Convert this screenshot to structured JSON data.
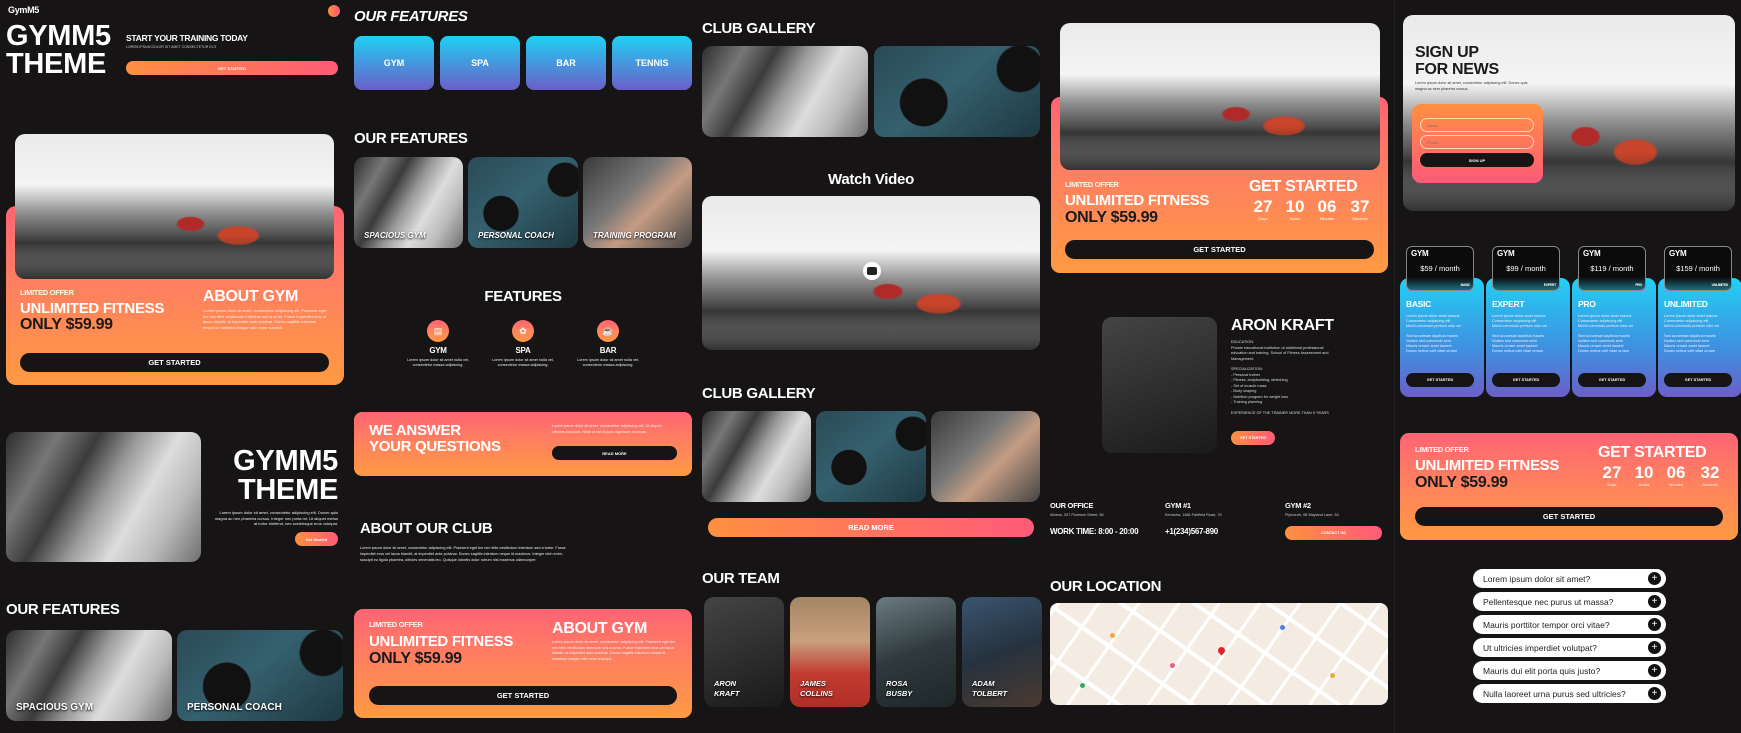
{
  "col1": {
    "brand": "GymM5",
    "hero_title_line1": "GYMM5",
    "hero_title_line2": "THEME",
    "hero_subtitle": "START YOUR TRAINING TODAY",
    "hero_text": "LOREM IPSUM DOLOR SIT AMET CONSECTETUR ELIT",
    "hero_button": "GET STARTED",
    "offer": {
      "kicker": "LIMITED OFFER",
      "title": "UNLIMITED FITNESS",
      "price": "ONLY $59.99",
      "about_title": "ABOUT GYM",
      "about_text": "Lorem ipsum dolor sit amet, consectetur adipiscing elit. Praesent eget leo nec felis vestibulum interdum sed a tortor. Fusce imperdiet eros ut lacus blandit, at imperdiet ante pulvinar. Donec sagittis interdum neque id maximus integer nibh enim suscipit.",
      "button": "GET STARTED"
    },
    "hero2": {
      "title_line1": "GYMM5",
      "title_line2": "THEME",
      "text": "Lorem ipsum dolor sit amet, consectetur adipiscing elit. Donec quis magna ac nen pharetra cursus. Integer nec porta mi. Ut aliquet metus at tortor eleifend, nec scelerisque eros volutpat.",
      "button": "Get Started"
    },
    "features_title": "OUR FEATURES",
    "features": [
      {
        "caption": "SPACIOUS GYM"
      },
      {
        "caption": "PERSONAL COACH"
      }
    ]
  },
  "col2": {
    "tiles_title": "OUR FEATURES",
    "tiles": [
      "GYM",
      "SPA",
      "BAR",
      "TENNIS"
    ],
    "photo_title": "OUR FEATURES",
    "photos": [
      {
        "caption": "SPACIOUS GYM"
      },
      {
        "caption": "PERSONAL COACH"
      },
      {
        "caption": "TRAINING PROGRAM"
      }
    ],
    "features_heading": "FEATURES",
    "features": [
      {
        "icon": "dumbbell-icon",
        "glyph": "▤",
        "title": "GYM",
        "text": "Lorem ipsum dolor sit amet nulla vel, consectetur massa adipiscing."
      },
      {
        "icon": "spa-icon",
        "glyph": "✿",
        "title": "SPA",
        "text": "Lorem ipsum dolor sit amet nulla vel, consectetur massa adipiscing."
      },
      {
        "icon": "cup-icon",
        "glyph": "☕",
        "title": "BAR",
        "text": "Lorem ipsum dolor sit amet nulla vel, consectetur massa adipiscing."
      }
    ],
    "faq_banner": {
      "title_line1": "WE ANSWER",
      "title_line2": "YOUR QUESTIONS",
      "text": "Lorem ipsum dolor sit amet, consectetur adipiscing elit. Ut aliquet ultricies tincidunt. Nulla ut est id justo dignissim rhoncus.",
      "button": "READ MORE"
    },
    "about_club": {
      "title": "ABOUT OUR CLUB",
      "text": "Lorem ipsum dolor sit amet, consectetur adipiscing elit. Praesent eget leo nec felis vestibulum interdum sed a tortor. Fusce imperdiet eros vel lacus blandit, at imperdiet ante pulvinar. Donec sagittis interdum neque id maximus. Integer nibh enim, suscipit eu ligula pharetra, ultrices venenatis leo. Quisque lobortis dolor rutrum nisl maximus ullamcorper."
    },
    "offer": {
      "kicker": "LIMITED OFFER",
      "title": "UNLIMITED FITNESS",
      "price": "ONLY $59.99",
      "about_title": "ABOUT GYM",
      "about_text": "Lorem ipsum dolor sit amet, consectetur adipiscing elit. Praesent eget leo nec felis vestibulum interdum sed a tortor. Fusce imperdiet eros vel lacus blandit, at imperdiet ante pulvinar. Donec sagittis interdum neque id maximus integer nibh enim suscipit.",
      "button": "GET STARTED"
    }
  },
  "col3": {
    "gallery_title": "CLUB GALLERY",
    "video_title": "Watch Video",
    "gallery2_title": "CLUB GALLERY",
    "read_more": "READ MORE",
    "team_title": "OUR TEAM",
    "team": [
      {
        "first": "ARON",
        "last": "KRAFT"
      },
      {
        "first": "JAMES",
        "last": "COLLINS"
      },
      {
        "first": "ROSA",
        "last": "BUSBY"
      },
      {
        "first": "ADAM",
        "last": "TOLBERT"
      }
    ]
  },
  "col4": {
    "offer": {
      "kicker": "LIMITED OFFER",
      "title": "UNLIMITED FITNESS",
      "price": "ONLY $59.99",
      "cta_title": "GET STARTED",
      "countdown": [
        {
          "value": "27",
          "label": "Days"
        },
        {
          "value": "10",
          "label": "Hours"
        },
        {
          "value": "06",
          "label": "Minutes"
        },
        {
          "value": "37",
          "label": "Seconds"
        }
      ],
      "button": "GET STARTED"
    },
    "trainer": {
      "name": "ARON KRAFT",
      "education_label": "EDUCATION:",
      "education": "Private educational institution of additional professional education and training. School of Fitness Assessment and Management.",
      "spec_label": "SPECIALIZATION:",
      "specs": [
        "- Personal trainer",
        "- Fitness, bodybuilding, stretching",
        "- Set of muscle mass",
        "- Body shaping",
        "- Nutrition program for weight loss",
        "- Training planning"
      ],
      "experience": "EXPERIENCE OF THE TRAINER MORE THAN 5 YEARS",
      "button": "GET STARTED"
    },
    "contacts": [
      {
        "title": "OUR OFFICE",
        "address": "Athens, 207 Florence Street, 56"
      },
      {
        "title": "GYM #1",
        "address": "Kenosha, 1486 Fairfield Road, 76"
      },
      {
        "title": "GYM #2",
        "address": "Plymouth, 98 Wayland Lane, 54"
      }
    ],
    "work_time": "WORK TIME: 8:00 - 20:00",
    "phone": "+1(234)567-890",
    "contact_button": "CONTACT US",
    "location_title": "OUR LOCATION"
  },
  "col5": {
    "signup": {
      "title_line1": "SIGN UP",
      "title_line2": "FOR NEWS",
      "text": "Lorem ipsum dolor sit amet, consectetur adipiscing elit. Donec quis magna ac sem pharetra cursus.",
      "name_placeholder": "Name",
      "phone_placeholder": "Phone",
      "button": "SIGN UP"
    },
    "pricing": [
      {
        "label": "GYM",
        "price": "$59 / month",
        "badge": "BASIC",
        "name": "BASIC",
        "button": "GET STARTED"
      },
      {
        "label": "GYM",
        "price": "$99 / month",
        "badge": "EXPERT",
        "name": "EXPERT",
        "button": "GET STARTED"
      },
      {
        "label": "GYM",
        "price": "$119 / month",
        "badge": "PRO",
        "name": "PRO",
        "button": "GET STARTED"
      },
      {
        "label": "GYM",
        "price": "$159 / month",
        "badge": "UNLIMITED",
        "name": "UNLIMITED",
        "button": "GET STARTED"
      }
    ],
    "pricing_features": [
      "Lorem ipsum dolor amet mauris",
      "Consectetur adipiscing elit",
      "Morbi commodo pretium odio vel",
      "",
      "Sed accumsan dapibus mauris",
      "Nullam sed commodo sem",
      "Mauris ornare amet laoreet",
      "Donec metus velit vitae ornare"
    ],
    "offer": {
      "kicker": "LIMITED OFFER",
      "title": "UNLIMITED FITNESS",
      "price": "ONLY $59.99",
      "cta_title": "GET STARTED",
      "countdown": [
        {
          "value": "27",
          "label": "Days"
        },
        {
          "value": "10",
          "label": "Hours"
        },
        {
          "value": "06",
          "label": "Minutes"
        },
        {
          "value": "32",
          "label": "Seconds"
        }
      ],
      "button": "GET STARTED"
    },
    "faq": [
      "Lorem ipsum dolor sit amet?",
      "Pellentesque nec purus ut massa?",
      "Mauris porttitor tempor orci vitae?",
      "Ut ultricies imperdiet volutpat?",
      "Mauris dui elit porta quis justo?",
      "Nulla laoreet urna purus sed ultricies?"
    ]
  },
  "colors": {
    "background": "#161414",
    "orange": "#ff9040",
    "pink": "#ff5a78",
    "cyan": "#22d0f4",
    "violet": "#6b5fc8"
  }
}
